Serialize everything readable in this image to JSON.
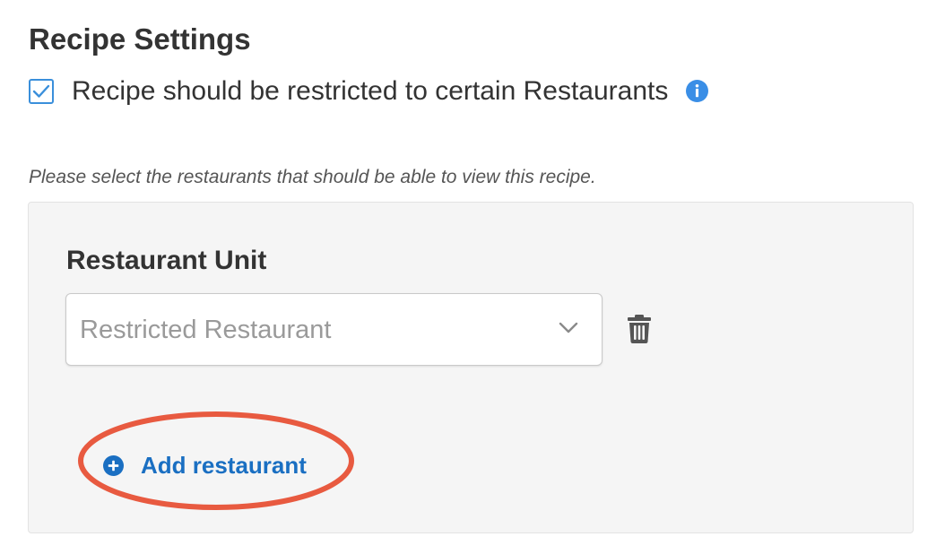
{
  "settings": {
    "title": "Recipe Settings",
    "restrict_checkbox": {
      "label": "Recipe should be restricted to certain Restaurants",
      "checked": true
    },
    "hint": "Please select the restaurants that should be able to view this recipe."
  },
  "restaurant_panel": {
    "unit_label": "Restaurant Unit",
    "select_value": "Restricted Restaurant",
    "add_button_label": "Add restaurant"
  },
  "icons": {
    "checkbox": "check-icon",
    "info": "info-icon",
    "chevron": "chevron-down-icon",
    "trash": "trash-icon",
    "add": "plus-circle-icon"
  },
  "colors": {
    "accent_blue": "#1a6fc2",
    "checkbox_blue": "#3a8fdb",
    "info_blue": "#3a8ee6",
    "highlight_red": "#e85a40",
    "panel_bg": "#f5f5f5"
  }
}
